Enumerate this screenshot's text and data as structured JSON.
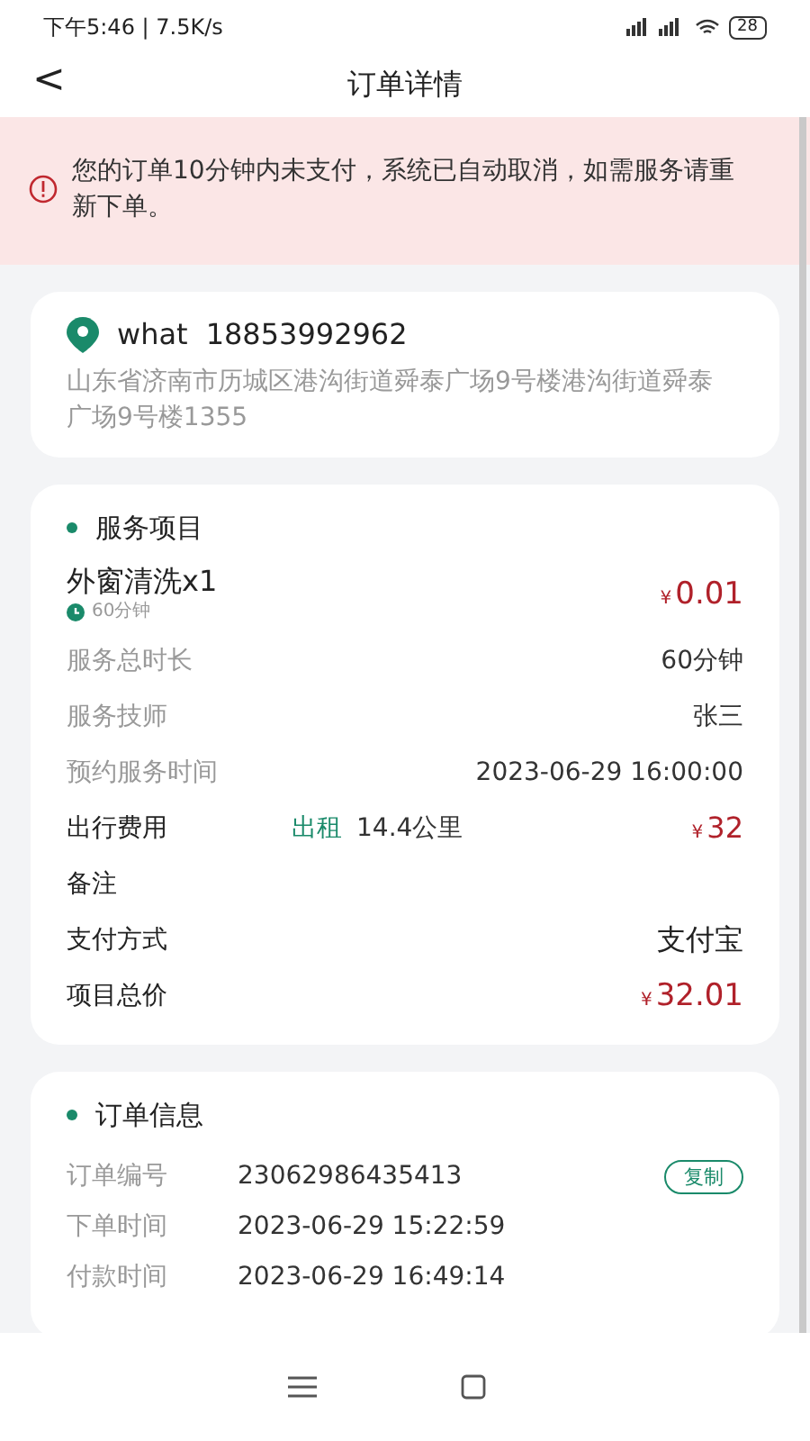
{
  "status_bar": {
    "time": "下午5:46 | 7.5K/s",
    "battery": "28"
  },
  "header": {
    "back": "<",
    "title": "订单详情"
  },
  "alert": {
    "text": "您的订单10分钟内未支付，系统已自动取消，如需服务请重新下单。"
  },
  "address": {
    "name": "what",
    "phone": "18853992962",
    "detail": "山东省济南市历城区港沟街道舜泰广场9号楼港沟街道舜泰广场9号楼1355"
  },
  "service": {
    "title": "服务项目",
    "item": {
      "name": "外窗清洗x1",
      "duration": "60分钟",
      "currency": "¥",
      "price": "0.01"
    },
    "rows": [
      {
        "kind": "plain",
        "label": "服务总时长",
        "value": "60分钟"
      },
      {
        "kind": "plain",
        "label": "服务技师",
        "value": "张三"
      },
      {
        "kind": "plain",
        "label": "预约服务时间",
        "value": "2023-06-29 16:00:00"
      },
      {
        "kind": "travel",
        "label": "出行费用",
        "mode": "出租",
        "distance": "14.4公里",
        "currency": "¥",
        "value": "32"
      },
      {
        "kind": "note",
        "label": "备注"
      },
      {
        "kind": "strong",
        "label": "支付方式",
        "value": "支付宝"
      },
      {
        "kind": "price",
        "label": "项目总价",
        "currency": "¥",
        "value": "32.01"
      }
    ]
  },
  "order": {
    "title": "订单信息",
    "rows": [
      {
        "label": "订单编号",
        "value": "23062986435413",
        "action": "复制"
      },
      {
        "label": "下单时间",
        "value": "2023-06-29 15:22:59"
      },
      {
        "label": "付款时间",
        "value": "2023-06-29 16:49:14"
      }
    ]
  }
}
